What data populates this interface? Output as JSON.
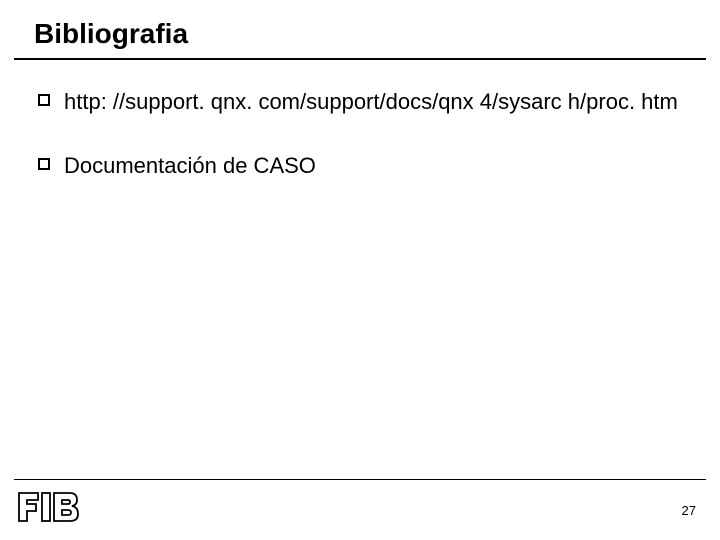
{
  "slide": {
    "title": "Bibliografia",
    "bullets": [
      "http: //support. qnx. com/support/docs/qnx 4/sysarc h/proc. htm",
      "Documentación de CASO"
    ],
    "page_number": "27",
    "logo_text": "FIB"
  }
}
